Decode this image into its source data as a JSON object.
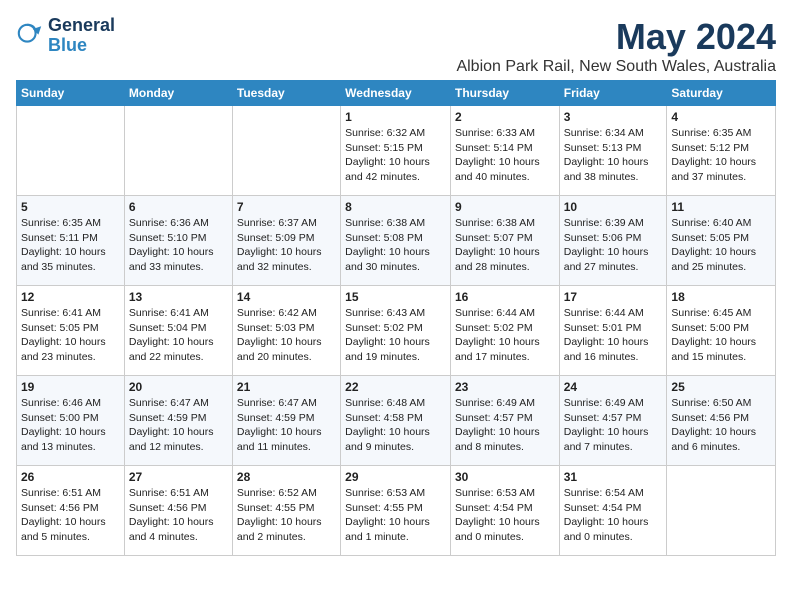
{
  "header": {
    "logo_line1": "General",
    "logo_line2": "Blue",
    "title": "May 2024",
    "subtitle": "Albion Park Rail, New South Wales, Australia"
  },
  "calendar": {
    "days_of_week": [
      "Sunday",
      "Monday",
      "Tuesday",
      "Wednesday",
      "Thursday",
      "Friday",
      "Saturday"
    ],
    "weeks": [
      [
        {
          "day": "",
          "info": ""
        },
        {
          "day": "",
          "info": ""
        },
        {
          "day": "",
          "info": ""
        },
        {
          "day": "1",
          "info": "Sunrise: 6:32 AM\nSunset: 5:15 PM\nDaylight: 10 hours\nand 42 minutes."
        },
        {
          "day": "2",
          "info": "Sunrise: 6:33 AM\nSunset: 5:14 PM\nDaylight: 10 hours\nand 40 minutes."
        },
        {
          "day": "3",
          "info": "Sunrise: 6:34 AM\nSunset: 5:13 PM\nDaylight: 10 hours\nand 38 minutes."
        },
        {
          "day": "4",
          "info": "Sunrise: 6:35 AM\nSunset: 5:12 PM\nDaylight: 10 hours\nand 37 minutes."
        }
      ],
      [
        {
          "day": "5",
          "info": "Sunrise: 6:35 AM\nSunset: 5:11 PM\nDaylight: 10 hours\nand 35 minutes."
        },
        {
          "day": "6",
          "info": "Sunrise: 6:36 AM\nSunset: 5:10 PM\nDaylight: 10 hours\nand 33 minutes."
        },
        {
          "day": "7",
          "info": "Sunrise: 6:37 AM\nSunset: 5:09 PM\nDaylight: 10 hours\nand 32 minutes."
        },
        {
          "day": "8",
          "info": "Sunrise: 6:38 AM\nSunset: 5:08 PM\nDaylight: 10 hours\nand 30 minutes."
        },
        {
          "day": "9",
          "info": "Sunrise: 6:38 AM\nSunset: 5:07 PM\nDaylight: 10 hours\nand 28 minutes."
        },
        {
          "day": "10",
          "info": "Sunrise: 6:39 AM\nSunset: 5:06 PM\nDaylight: 10 hours\nand 27 minutes."
        },
        {
          "day": "11",
          "info": "Sunrise: 6:40 AM\nSunset: 5:05 PM\nDaylight: 10 hours\nand 25 minutes."
        }
      ],
      [
        {
          "day": "12",
          "info": "Sunrise: 6:41 AM\nSunset: 5:05 PM\nDaylight: 10 hours\nand 23 minutes."
        },
        {
          "day": "13",
          "info": "Sunrise: 6:41 AM\nSunset: 5:04 PM\nDaylight: 10 hours\nand 22 minutes."
        },
        {
          "day": "14",
          "info": "Sunrise: 6:42 AM\nSunset: 5:03 PM\nDaylight: 10 hours\nand 20 minutes."
        },
        {
          "day": "15",
          "info": "Sunrise: 6:43 AM\nSunset: 5:02 PM\nDaylight: 10 hours\nand 19 minutes."
        },
        {
          "day": "16",
          "info": "Sunrise: 6:44 AM\nSunset: 5:02 PM\nDaylight: 10 hours\nand 17 minutes."
        },
        {
          "day": "17",
          "info": "Sunrise: 6:44 AM\nSunset: 5:01 PM\nDaylight: 10 hours\nand 16 minutes."
        },
        {
          "day": "18",
          "info": "Sunrise: 6:45 AM\nSunset: 5:00 PM\nDaylight: 10 hours\nand 15 minutes."
        }
      ],
      [
        {
          "day": "19",
          "info": "Sunrise: 6:46 AM\nSunset: 5:00 PM\nDaylight: 10 hours\nand 13 minutes."
        },
        {
          "day": "20",
          "info": "Sunrise: 6:47 AM\nSunset: 4:59 PM\nDaylight: 10 hours\nand 12 minutes."
        },
        {
          "day": "21",
          "info": "Sunrise: 6:47 AM\nSunset: 4:59 PM\nDaylight: 10 hours\nand 11 minutes."
        },
        {
          "day": "22",
          "info": "Sunrise: 6:48 AM\nSunset: 4:58 PM\nDaylight: 10 hours\nand 9 minutes."
        },
        {
          "day": "23",
          "info": "Sunrise: 6:49 AM\nSunset: 4:57 PM\nDaylight: 10 hours\nand 8 minutes."
        },
        {
          "day": "24",
          "info": "Sunrise: 6:49 AM\nSunset: 4:57 PM\nDaylight: 10 hours\nand 7 minutes."
        },
        {
          "day": "25",
          "info": "Sunrise: 6:50 AM\nSunset: 4:56 PM\nDaylight: 10 hours\nand 6 minutes."
        }
      ],
      [
        {
          "day": "26",
          "info": "Sunrise: 6:51 AM\nSunset: 4:56 PM\nDaylight: 10 hours\nand 5 minutes."
        },
        {
          "day": "27",
          "info": "Sunrise: 6:51 AM\nSunset: 4:56 PM\nDaylight: 10 hours\nand 4 minutes."
        },
        {
          "day": "28",
          "info": "Sunrise: 6:52 AM\nSunset: 4:55 PM\nDaylight: 10 hours\nand 2 minutes."
        },
        {
          "day": "29",
          "info": "Sunrise: 6:53 AM\nSunset: 4:55 PM\nDaylight: 10 hours\nand 1 minute."
        },
        {
          "day": "30",
          "info": "Sunrise: 6:53 AM\nSunset: 4:54 PM\nDaylight: 10 hours\nand 0 minutes."
        },
        {
          "day": "31",
          "info": "Sunrise: 6:54 AM\nSunset: 4:54 PM\nDaylight: 10 hours\nand 0 minutes."
        },
        {
          "day": "",
          "info": ""
        }
      ]
    ]
  }
}
